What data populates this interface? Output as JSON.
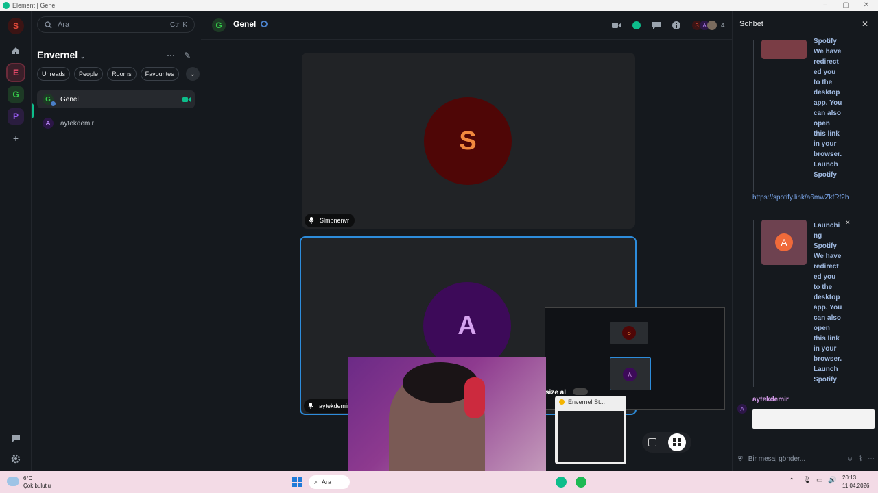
{
  "window": {
    "title": "Element | Genel"
  },
  "spaces": {
    "current_space_initial": "S",
    "items": [
      {
        "initial": "E",
        "color": "#ea4c6c",
        "bg": "#3a1f29"
      },
      {
        "initial": "G",
        "color": "#36cc4b",
        "bg": "#1d3a25"
      },
      {
        "initial": "P",
        "color": "#9a5cf5",
        "bg": "#2a1d3f"
      }
    ]
  },
  "search": {
    "placeholder": "Ara",
    "shortcut": "Ctrl K"
  },
  "space": {
    "name": "Envernel"
  },
  "filters": [
    "Unreads",
    "People",
    "Rooms",
    "Favourites"
  ],
  "rooms": [
    {
      "initial": "G",
      "name": "Genel"
    },
    {
      "initial": "A",
      "name": "aytekdemir"
    }
  ],
  "room_header": {
    "initial": "G",
    "title": "Genel",
    "member_count": "4",
    "facepile": [
      "S",
      "A"
    ]
  },
  "call": {
    "participants": [
      {
        "initial": "S",
        "name": "Slmbnenvr"
      },
      {
        "initial": "A",
        "name": "aytekdemir"
      }
    ]
  },
  "right_panel": {
    "title": "Sohbet",
    "card1_text": [
      "Spotify",
      "We have",
      "redirect",
      "ed you",
      "to the",
      "desktop",
      "app. You",
      "can also",
      "open",
      "this link",
      "in your",
      "browser.",
      "Launch",
      "Spotify"
    ],
    "link": "https://spotify.link/a6mwZkfRf2b",
    "card2_text": [
      "Launchi",
      "ng",
      "Spotify",
      "We have",
      "redirect",
      "ed you",
      "to the",
      "desktop",
      "app. You",
      "can also",
      "open",
      "this link",
      "in your",
      "browser.",
      "Launch",
      "Spotify"
    ],
    "card2_avatar": "A",
    "sender": "aytekdemir",
    "sender_initial": "A",
    "composer_placeholder": "Bir mesaj gönder..."
  },
  "overlay": {
    "popup_text": "size al",
    "tab_title": "Envernel St..."
  },
  "taskbar": {
    "weather_temp": "6°C",
    "weather_desc": "Çok bulutlu",
    "search": "Ara",
    "time": "20:13",
    "date": "11.04.2026"
  }
}
